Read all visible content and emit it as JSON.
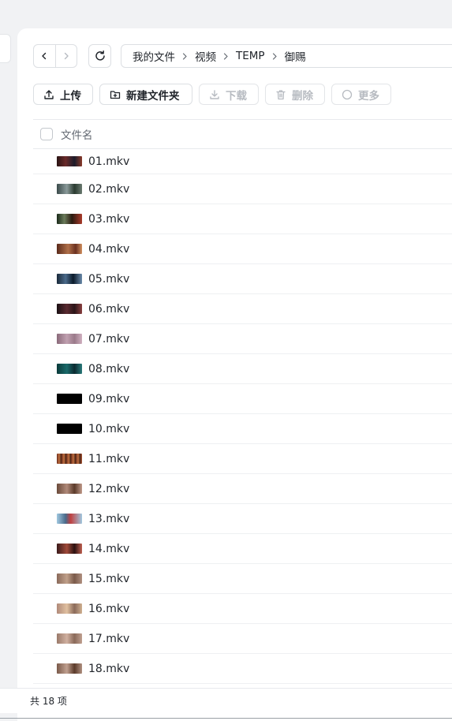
{
  "nav": {
    "back_icon": "chevron-left-icon",
    "forward_icon": "chevron-right-icon",
    "refresh_icon": "refresh-icon"
  },
  "breadcrumb": [
    "我的文件",
    "视频",
    "TEMP",
    "御赐"
  ],
  "toolbar": {
    "upload": "上传",
    "new_folder": "新建文件夹",
    "download": "下载",
    "delete": "删除",
    "more": "更多"
  },
  "list": {
    "header": "文件名",
    "files": [
      {
        "name": "01.mkv",
        "thumb": "linear-gradient(90deg,#2a1414 0%,#6a2a2a 35%,#1c1c2a 70%,#8a3a2a 100%)"
      },
      {
        "name": "02.mkv",
        "thumb": "linear-gradient(90deg,#3a4a4a 0%,#8a9a9a 40%,#2a3a30 70%,#6a7a70 100%)"
      },
      {
        "name": "03.mkv",
        "thumb": "linear-gradient(90deg,#1a2a1a 0%,#6a7a5a 30%,#2a1a10 60%,#aa3a2a 100%)"
      },
      {
        "name": "04.mkv",
        "thumb": "linear-gradient(90deg,#5a2a1a 0%,#b0704a 45%,#6a3020 75%,#d09060 100%)"
      },
      {
        "name": "05.mkv",
        "thumb": "linear-gradient(90deg,#1a2a3a 0%,#4a6a8a 35%,#0a1a2a 65%,#6a8aaa 100%)"
      },
      {
        "name": "06.mkv",
        "thumb": "linear-gradient(90deg,#1a1014 0%,#5a2a30 40%,#2a1418 70%,#8a4040 100%)"
      },
      {
        "name": "07.mkv",
        "thumb": "linear-gradient(90deg,#8a6a7a 0%,#c0a0b0 40%,#9a7a8a 70%,#d0b0c0 100%)"
      },
      {
        "name": "08.mkv",
        "thumb": "linear-gradient(90deg,#0a3a3a 0%,#1a6a6a 40%,#0a2a30 70%,#2a7a7a 100%)"
      },
      {
        "name": "09.mkv",
        "thumb": "#000000"
      },
      {
        "name": "10.mkv",
        "thumb": "#000000"
      },
      {
        "name": "11.mkv",
        "thumb": "repeating-linear-gradient(90deg,#6a2a1a 0px,#c07040 3px,#3a1a10 6px)"
      },
      {
        "name": "12.mkv",
        "thumb": "linear-gradient(90deg,#6a4a3a 0%,#b08a7a 40%,#5a3a2a 70%,#c09a8a 100%)"
      },
      {
        "name": "13.mkv",
        "thumb": "linear-gradient(90deg,#a0c8e0 0%,#4a6a8a 35%,#c04040 55%,#a0c8e0 100%)"
      },
      {
        "name": "14.mkv",
        "thumb": "linear-gradient(90deg,#3a1a1a 0%,#a04a3a 40%,#2a1010 70%,#c06050 100%)"
      },
      {
        "name": "15.mkv",
        "thumb": "linear-gradient(90deg,#8a6a5a 0%,#c0a08a 40%,#7a5a4a 70%,#b09080 100%)"
      },
      {
        "name": "16.mkv",
        "thumb": "linear-gradient(90deg,#b08a7a 0%,#e0c0a0 40%,#8a6a5a 70%,#d0b090 100%)"
      },
      {
        "name": "17.mkv",
        "thumb": "linear-gradient(90deg,#9a7a6a 0%,#d0b0a0 40%,#8a6a5a 70%,#c0a090 100%)"
      },
      {
        "name": "18.mkv",
        "thumb": "linear-gradient(90deg,#7a5a4a 0%,#c0a090 40%,#5a3a2a 70%,#b09080 100%)"
      }
    ]
  },
  "status": {
    "summary": "共 18 项"
  }
}
